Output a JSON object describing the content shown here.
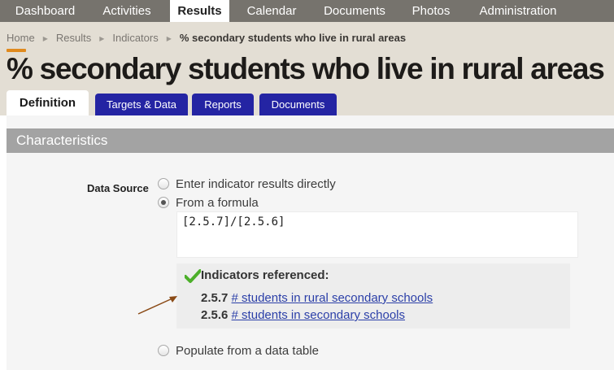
{
  "nav": {
    "tabs": [
      {
        "label": "Dashboard"
      },
      {
        "label": "Activities"
      },
      {
        "label": "Results"
      },
      {
        "label": "Calendar"
      },
      {
        "label": "Documents"
      },
      {
        "label": "Photos"
      },
      {
        "label": "Administration"
      }
    ],
    "active_tab": "Results"
  },
  "breadcrumb": {
    "items": [
      "Home",
      "Results",
      "Indicators"
    ],
    "current": "% secondary students who live in rural areas"
  },
  "page_title": "% secondary students who live in rural areas",
  "subtabs": [
    {
      "label": "Definition"
    },
    {
      "label": "Targets & Data"
    },
    {
      "label": "Reports"
    },
    {
      "label": "Documents"
    }
  ],
  "active_subtab": "Definition",
  "section": {
    "title": "Characteristics"
  },
  "data_source": {
    "label": "Data Source",
    "options": [
      {
        "label": "Enter indicator results directly",
        "checked": false
      },
      {
        "label": "From a formula",
        "checked": true
      },
      {
        "label": "Populate from a data table",
        "checked": false
      }
    ],
    "formula": "[2.5.7]/[2.5.6]",
    "references": {
      "title": "Indicators referenced:",
      "items": [
        {
          "code": "2.5.7",
          "name": "# students in rural secondary schools"
        },
        {
          "code": "2.5.6",
          "name": "# students in secondary schools"
        }
      ]
    }
  },
  "colors": {
    "nav_bg": "#76736d",
    "header_bg": "#e3ded4",
    "accent": "#e08a1e",
    "subtab_bg": "#2424a3",
    "section_bg": "#a3a3a3",
    "link": "#2b3fa8",
    "check": "#4caf2a",
    "arrow": "#8a4a16"
  }
}
